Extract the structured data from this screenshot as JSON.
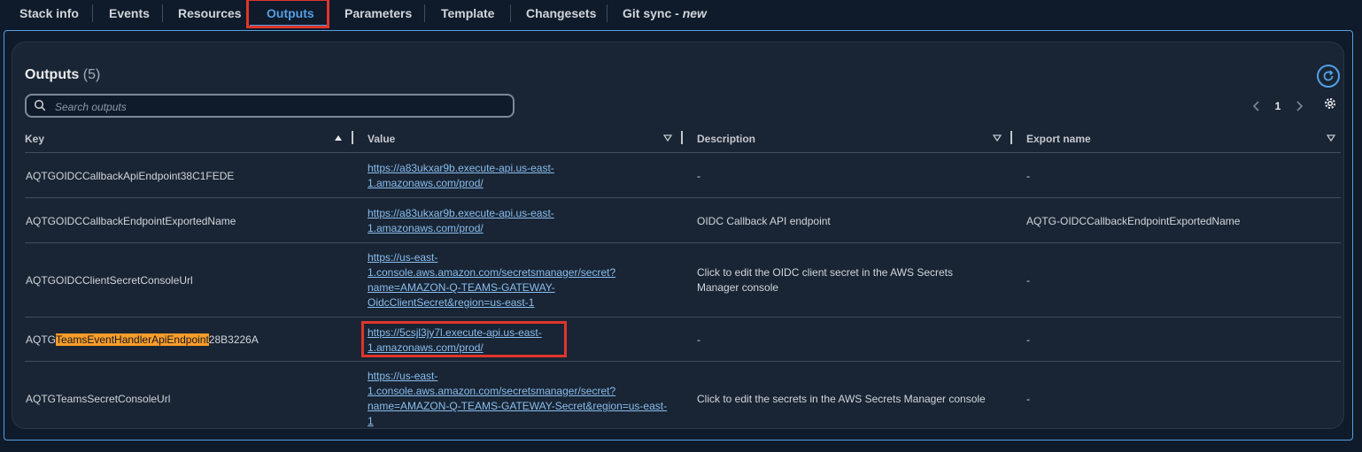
{
  "tabs": [
    {
      "label": "Stack info"
    },
    {
      "label": "Events"
    },
    {
      "label": "Resources"
    },
    {
      "label": "Outputs"
    },
    {
      "label": "Parameters"
    },
    {
      "label": "Template"
    },
    {
      "label": "Changesets"
    },
    {
      "label": "Git sync - ",
      "suffix": "new"
    }
  ],
  "active_tab": "Outputs",
  "panel": {
    "title": "Outputs",
    "count": "(5)"
  },
  "search": {
    "placeholder": "Search outputs",
    "value": ""
  },
  "pagination": {
    "current_page": "1"
  },
  "table": {
    "columns": [
      "Key",
      "Value",
      "Description",
      "Export name"
    ],
    "rows": [
      {
        "key": "AQTGOIDCCallbackApiEndpoint38C1FEDE",
        "value_lines": [
          "https://a83ukxar9b.execute-api.us-east-",
          "1.amazonaws.com/prod/"
        ],
        "description": "-",
        "export_name": "-"
      },
      {
        "key": "AQTGOIDCCallbackEndpointExportedName",
        "value_lines": [
          "https://a83ukxar9b.execute-api.us-east-",
          "1.amazonaws.com/prod/"
        ],
        "description": "OIDC Callback API endpoint",
        "export_name": "AQTG-OIDCCallbackEndpointExportedName"
      },
      {
        "key": "AQTGOIDCClientSecretConsoleUrl",
        "value_lines": [
          "https://us-east-",
          "1.console.aws.amazon.com/secretsmanager/secret?",
          "name=AMAZON-Q-TEAMS-GATEWAY-",
          "OidcClientSecret&region=us-east-1"
        ],
        "description_lines": [
          "Click to edit the OIDC client secret in the AWS Secrets",
          "Manager console"
        ],
        "export_name": "-"
      },
      {
        "key_prefix": "AQTG",
        "key_highlight": "TeamsEventHandlerApiEndpoint",
        "key_suffix": "28B3226A",
        "value_lines": [
          "https://5csjl3jy7l.execute-api.us-east-",
          "1.amazonaws.com/prod/"
        ],
        "description": "-",
        "export_name": "-"
      },
      {
        "key": "AQTGTeamsSecretConsoleUrl",
        "value_lines": [
          "https://us-east-",
          "1.console.aws.amazon.com/secretsmanager/secret?",
          "name=AMAZON-Q-TEAMS-GATEWAY-Secret&region=us-east-",
          "1"
        ],
        "description": "Click to edit the secrets in the AWS Secrets Manager console",
        "export_name": "-"
      }
    ]
  },
  "icons": {
    "search": "search-icon",
    "refresh": "refresh-icon",
    "prev": "chevron-left-icon",
    "next": "chevron-right-icon",
    "settings": "gear-icon",
    "sort_asc": "caret-up-icon",
    "sort_none": "caret-down-outline-icon"
  },
  "colors": {
    "accent": "#539fe5",
    "link": "#89bdee",
    "highlight": "#f89c2a",
    "annotation_box": "#e0352b"
  }
}
